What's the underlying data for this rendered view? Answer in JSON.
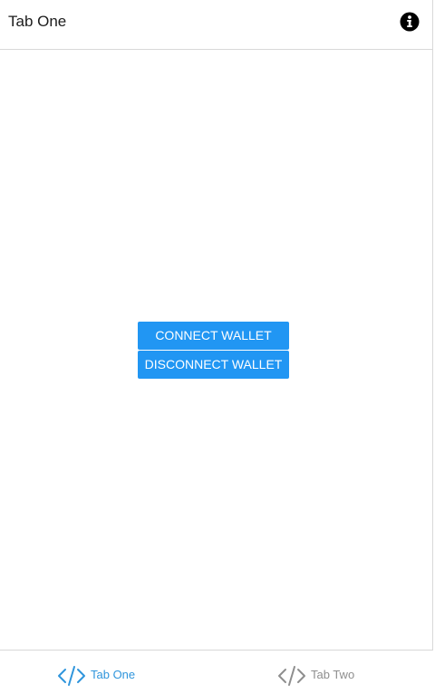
{
  "header": {
    "title": "Tab One",
    "info_icon": "info-circle-icon"
  },
  "main": {
    "connect_label": "CONNECT WALLET",
    "disconnect_label": "DISCONNECT WALLET"
  },
  "tabbar": {
    "tabs": [
      {
        "label": "Tab One",
        "icon": "code-icon",
        "active": true,
        "color": "#2f95dc"
      },
      {
        "label": "Tab Two",
        "icon": "code-icon",
        "active": false,
        "color": "#8e8e8e"
      }
    ]
  },
  "colors": {
    "button_background": "#2196f3",
    "button_text": "#ffffff",
    "active_tab": "#2f95dc",
    "inactive_tab": "#8e8e8e"
  }
}
